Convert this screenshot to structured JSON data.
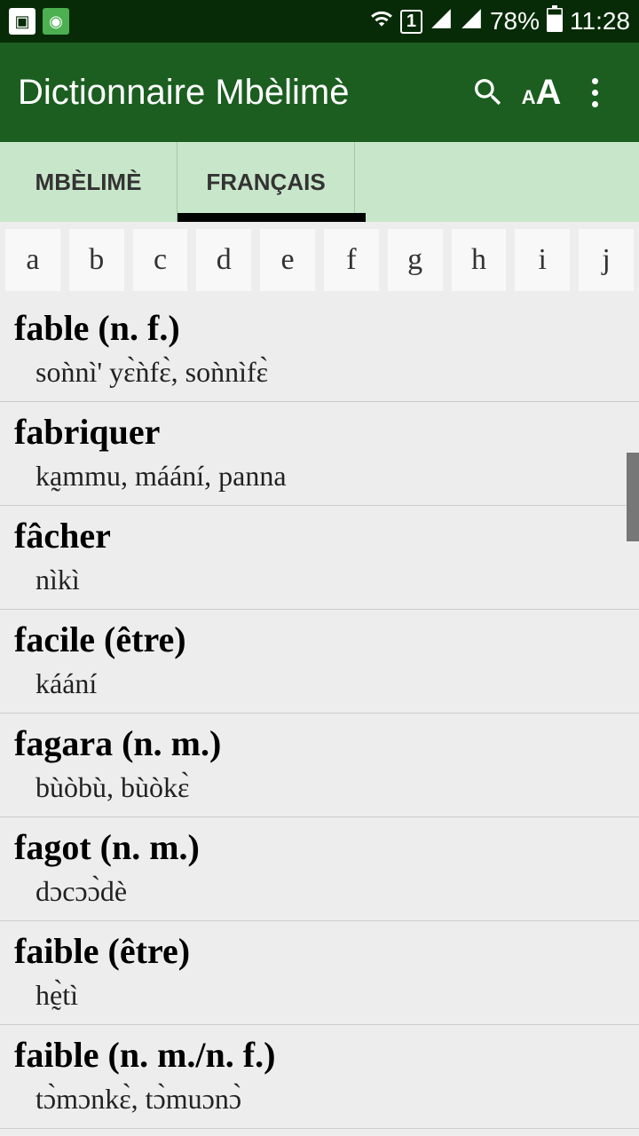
{
  "status": {
    "battery": "78%",
    "time": "11:28"
  },
  "app": {
    "title": "Dictionnaire Mbèlimè"
  },
  "tabs": {
    "tab1": "MBÈLIMÈ",
    "tab2": "FRANÇAIS"
  },
  "alpha": [
    "a",
    "b",
    "c",
    "d",
    "e",
    "f",
    "g",
    "h",
    "i",
    "j"
  ],
  "entries": [
    {
      "head": "fable (n. f.)",
      "def": "soǹnì' yɛ̀ǹfɛ̀, soǹnìfɛ̀"
    },
    {
      "head": "fabriquer",
      "def": "ka̰mmu, máání, panna"
    },
    {
      "head": "fâcher",
      "def": "nìkì"
    },
    {
      "head": "facile (être)",
      "def": "káání"
    },
    {
      "head": "fagara (n. m.)",
      "def": "bùòbù, bùòkɛ̀"
    },
    {
      "head": "fagot (n. m.)",
      "def": "dɔcɔɔ̀dè"
    },
    {
      "head": "faible (être)",
      "def": "hḛ̀tì"
    },
    {
      "head": "faible (n. m./n. f.)",
      "def": "tɔ̀mɔnkɛ̀, tɔ̀muɔnɔ̀"
    }
  ]
}
